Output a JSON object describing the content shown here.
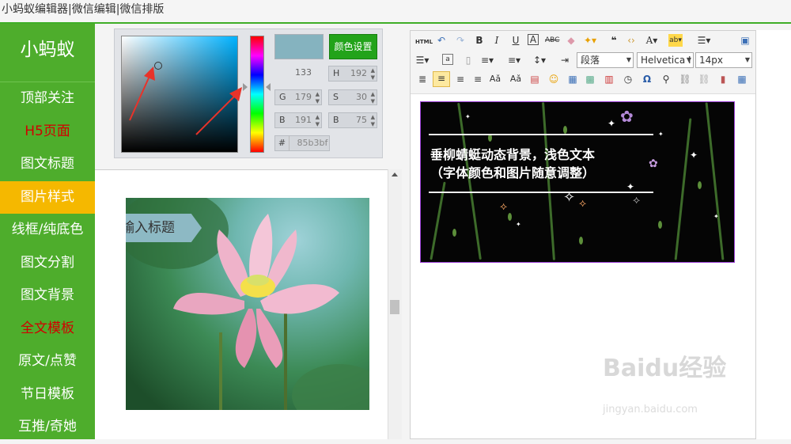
{
  "window": {
    "title": "小蚂蚁编辑器|微信编辑|微信排版"
  },
  "sidebar": {
    "logo": "小蚂蚁",
    "items": [
      {
        "label": "顶部关注"
      },
      {
        "label": "H5页面"
      },
      {
        "label": "图文标题"
      },
      {
        "label": "图片样式"
      },
      {
        "label": "线框/纯底色"
      },
      {
        "label": "图文分割"
      },
      {
        "label": "图文背景"
      },
      {
        "label": "全文模板"
      },
      {
        "label": "原文/点赞"
      },
      {
        "label": "节日模板"
      },
      {
        "label": "互推/奇她"
      }
    ]
  },
  "color_picker": {
    "set_button": "颜色设置",
    "swatch_color": "#85b3bf",
    "value_133": "133",
    "H": {
      "label": "H",
      "value": "192"
    },
    "S": {
      "label": "S",
      "value": "30"
    },
    "B2": {
      "label": "B",
      "value": "75"
    },
    "G": {
      "label": "G",
      "value": "179"
    },
    "Bc": {
      "label": "B",
      "value": "191"
    },
    "hex": {
      "label": "#",
      "value": "85b3bf"
    }
  },
  "preview": {
    "title_tag": "输入标题"
  },
  "editor": {
    "toolbar": {
      "paragraph_select": "段落",
      "font_select": "Helvetica I",
      "size_select": "14px"
    },
    "content": {
      "line1": "垂柳蜻蜓动态背景，浅色文本",
      "line2": "（字体颜色和图片随意调整）"
    }
  },
  "watermark": {
    "brand": "Baidu经验",
    "url": "jingyan.baidu.com"
  },
  "colors": {
    "accent": "#4ead2c",
    "active": "#f5b800",
    "red_item": "#d10000",
    "button": "#22a31a",
    "frame": "#9b3fd6"
  }
}
